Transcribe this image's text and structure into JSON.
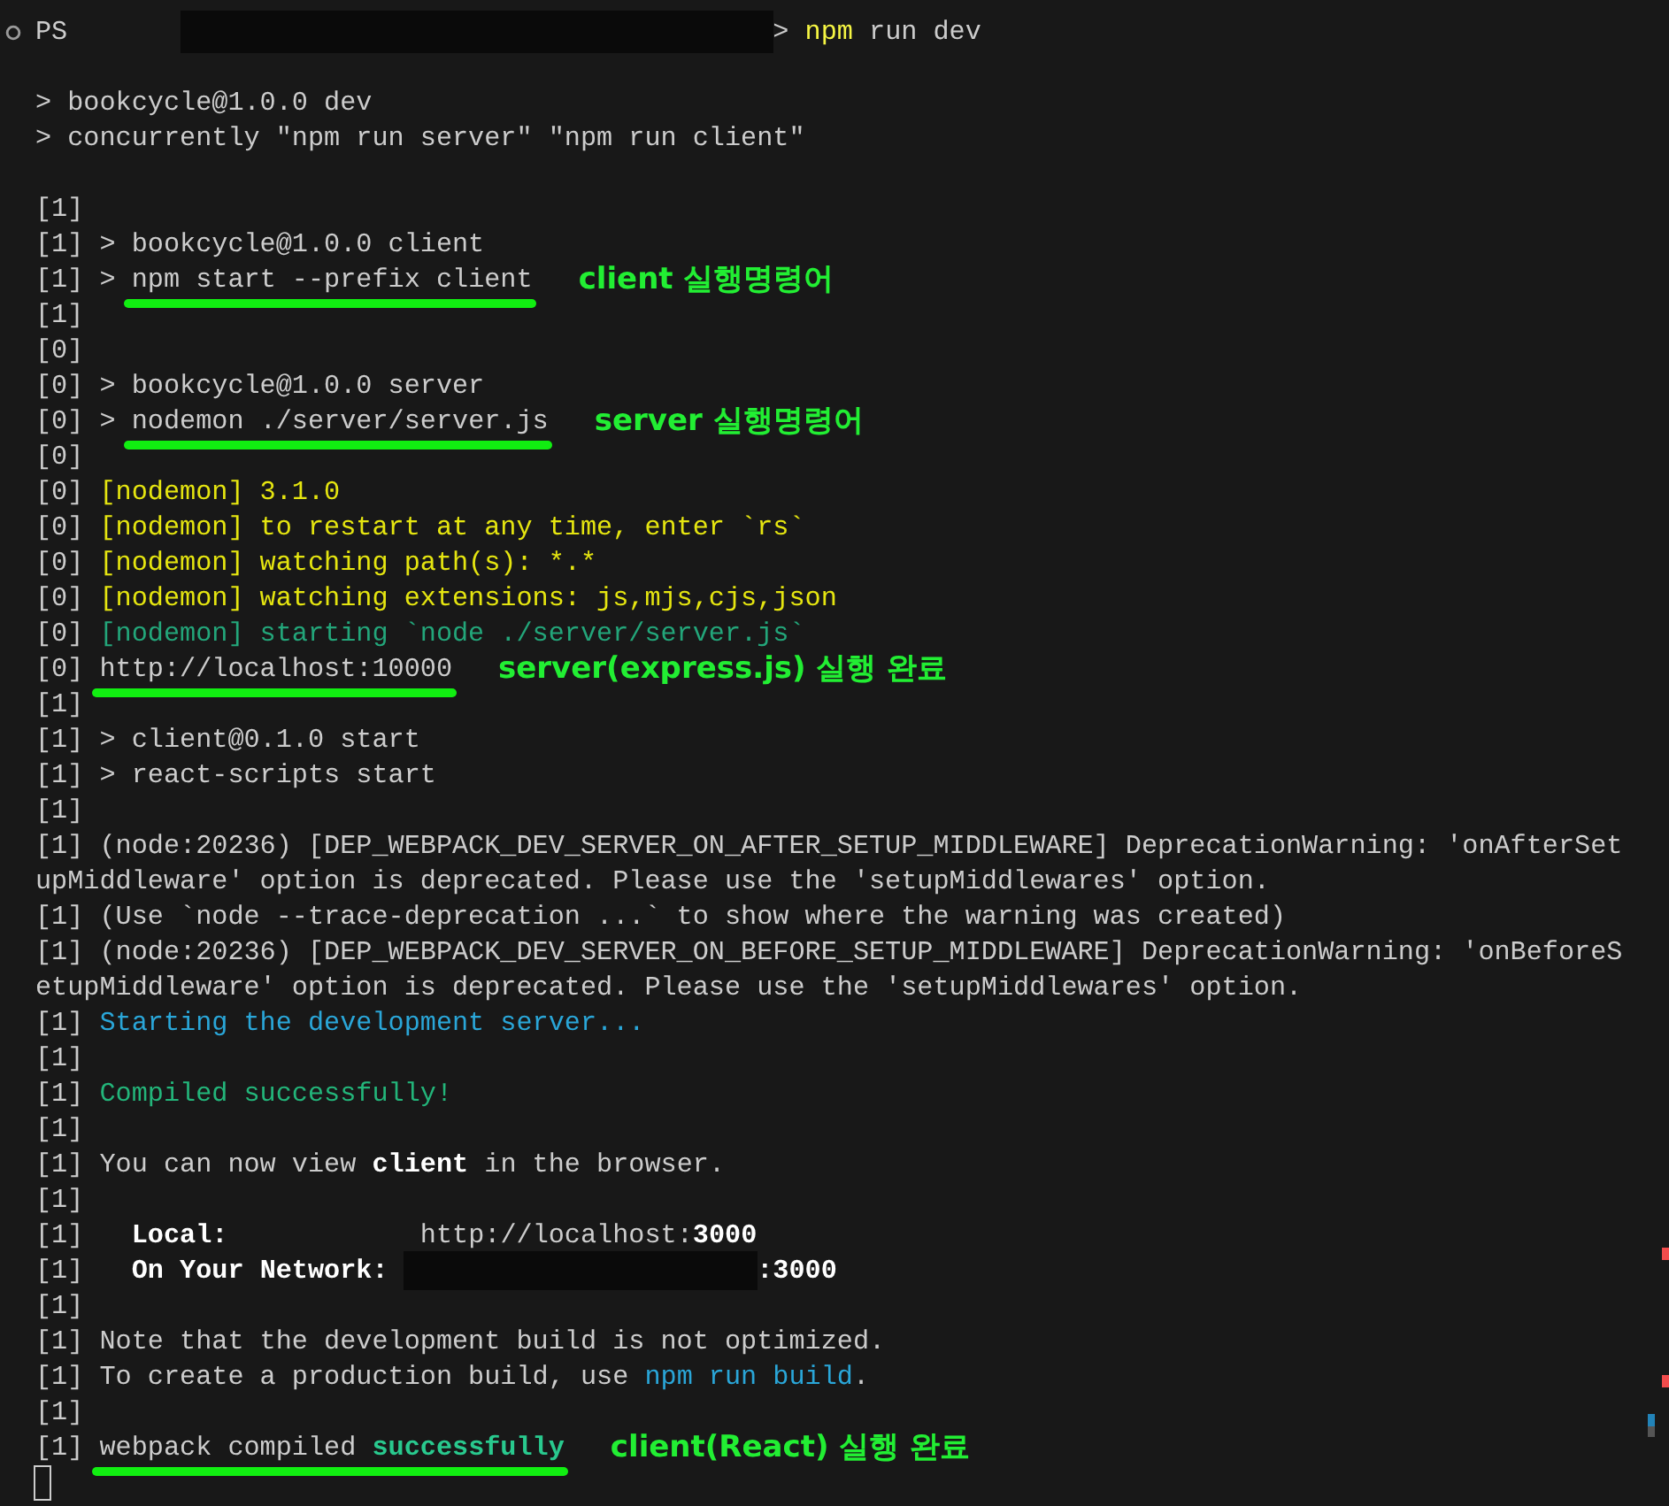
{
  "terminal": {
    "lines": [
      {
        "segments": [
          {
            "kind": "prompt_icon"
          },
          {
            "kind": "plain",
            "text": "PS"
          },
          {
            "kind": "redacted_path"
          },
          {
            "kind": "plain",
            "text": "> "
          },
          {
            "kind": "command",
            "text": "npm"
          },
          {
            "kind": "plain",
            "text": " run dev"
          }
        ],
        "blank_line_after": true
      },
      {
        "segments": [
          {
            "kind": "plain",
            "text": "> bookcycle@1.0.0 dev"
          }
        ]
      },
      {
        "segments": [
          {
            "kind": "plain",
            "text": "> concurrently \"npm run server\" \"npm run client\""
          }
        ],
        "blank_line_after": true
      },
      {
        "segments": [
          {
            "kind": "plain",
            "text": "[1]"
          }
        ]
      },
      {
        "segments": [
          {
            "kind": "plain",
            "text": "[1] > bookcycle@1.0.0 client"
          }
        ]
      },
      {
        "segments": [
          {
            "kind": "plain",
            "text": "[1] > "
          },
          {
            "kind": "underlined",
            "parts": [
              {
                "kind": "plain",
                "text": "npm start --prefix client"
              }
            ]
          }
        ],
        "note": "client 실행명령어"
      },
      {
        "segments": [
          {
            "kind": "plain",
            "text": "[1]"
          }
        ]
      },
      {
        "segments": [
          {
            "kind": "plain",
            "text": "[0]"
          }
        ]
      },
      {
        "segments": [
          {
            "kind": "plain",
            "text": "[0] > bookcycle@1.0.0 server"
          }
        ]
      },
      {
        "segments": [
          {
            "kind": "plain",
            "text": "[0] > "
          },
          {
            "kind": "underlined",
            "parts": [
              {
                "kind": "plain",
                "text": "nodemon ./server/server.js"
              }
            ]
          }
        ],
        "note": "server 실행명령어"
      },
      {
        "segments": [
          {
            "kind": "plain",
            "text": "[0]"
          }
        ]
      },
      {
        "segments": [
          {
            "kind": "plain",
            "text": "[0] "
          },
          {
            "kind": "yellow",
            "text": "[nodemon] 3.1.0"
          }
        ]
      },
      {
        "segments": [
          {
            "kind": "plain",
            "text": "[0] "
          },
          {
            "kind": "yellow",
            "text": "[nodemon] to restart at any time, enter `rs`"
          }
        ]
      },
      {
        "segments": [
          {
            "kind": "plain",
            "text": "[0] "
          },
          {
            "kind": "yellow",
            "text": "[nodemon] watching path(s): *.*"
          }
        ]
      },
      {
        "segments": [
          {
            "kind": "plain",
            "text": "[0] "
          },
          {
            "kind": "yellow",
            "text": "[nodemon] watching extensions: js,mjs,cjs,json"
          }
        ]
      },
      {
        "segments": [
          {
            "kind": "plain",
            "text": "[0] "
          },
          {
            "kind": "teal",
            "text": "[nodemon] starting `node ./server/server.js`"
          }
        ]
      },
      {
        "segments": [
          {
            "kind": "plain",
            "text": "[0] "
          },
          {
            "kind": "underlined",
            "parts": [
              {
                "kind": "plain",
                "text": "http://localhost:10000"
              }
            ]
          }
        ],
        "note": "server(express.js) 실행 완료"
      },
      {
        "segments": [
          {
            "kind": "plain",
            "text": "[1]"
          }
        ]
      },
      {
        "segments": [
          {
            "kind": "plain",
            "text": "[1] > client@0.1.0 start"
          }
        ]
      },
      {
        "segments": [
          {
            "kind": "plain",
            "text": "[1] > react-scripts start"
          }
        ]
      },
      {
        "segments": [
          {
            "kind": "plain",
            "text": "[1]"
          }
        ]
      },
      {
        "segments": [
          {
            "kind": "plain",
            "text": "[1] (node:20236) [DEP_WEBPACK_DEV_SERVER_ON_AFTER_SETUP_MIDDLEWARE] DeprecationWarning: 'onAfterSet"
          }
        ]
      },
      {
        "segments": [
          {
            "kind": "plain",
            "text": "upMiddleware' option is deprecated. Please use the 'setupMiddlewares' option."
          }
        ]
      },
      {
        "segments": [
          {
            "kind": "plain",
            "text": "[1] (Use `node --trace-deprecation ...` to show where the warning was created)"
          }
        ]
      },
      {
        "segments": [
          {
            "kind": "plain",
            "text": "[1] (node:20236) [DEP_WEBPACK_DEV_SERVER_ON_BEFORE_SETUP_MIDDLEWARE] DeprecationWarning: 'onBeforeS"
          }
        ]
      },
      {
        "segments": [
          {
            "kind": "plain",
            "text": "etupMiddleware' option is deprecated. Please use the 'setupMiddlewares' option."
          }
        ]
      },
      {
        "segments": [
          {
            "kind": "plain",
            "text": "[1] "
          },
          {
            "kind": "blue",
            "text": "Starting the development server..."
          }
        ]
      },
      {
        "segments": [
          {
            "kind": "plain",
            "text": "[1]"
          }
        ]
      },
      {
        "segments": [
          {
            "kind": "plain",
            "text": "[1] "
          },
          {
            "kind": "green",
            "text": "Compiled successfully!"
          }
        ]
      },
      {
        "segments": [
          {
            "kind": "plain",
            "text": "[1]"
          }
        ]
      },
      {
        "segments": [
          {
            "kind": "plain",
            "text": "[1] You can now view "
          },
          {
            "kind": "bold",
            "text": "client"
          },
          {
            "kind": "plain",
            "text": " in the browser."
          }
        ]
      },
      {
        "segments": [
          {
            "kind": "plain",
            "text": "[1]"
          }
        ]
      },
      {
        "segments": [
          {
            "kind": "plain",
            "text": "[1]   "
          },
          {
            "kind": "bold",
            "text": "Local:"
          },
          {
            "kind": "plain",
            "text": "            http://localhost:"
          },
          {
            "kind": "bold",
            "text": "3000"
          }
        ]
      },
      {
        "segments": [
          {
            "kind": "plain",
            "text": "[1]   "
          },
          {
            "kind": "bold",
            "text": "On Your Network:"
          },
          {
            "kind": "redacted_address"
          },
          {
            "kind": "bold",
            "text": ":3000"
          }
        ]
      },
      {
        "segments": [
          {
            "kind": "plain",
            "text": "[1]"
          }
        ]
      },
      {
        "segments": [
          {
            "kind": "plain",
            "text": "[1] Note that the development build is not optimized."
          }
        ]
      },
      {
        "segments": [
          {
            "kind": "plain",
            "text": "[1] To create a production build, use "
          },
          {
            "kind": "blue",
            "text": "npm run build"
          },
          {
            "kind": "plain",
            "text": "."
          }
        ]
      },
      {
        "segments": [
          {
            "kind": "plain",
            "text": "[1]"
          }
        ]
      },
      {
        "segments": [
          {
            "kind": "plain",
            "text": "[1] "
          },
          {
            "kind": "underlined",
            "parts": [
              {
                "kind": "plain",
                "text": "webpack compiled "
              },
              {
                "kind": "success",
                "text": "successfully"
              }
            ]
          }
        ],
        "note": "client(React) 실행 완료"
      },
      {
        "segments": [
          {
            "kind": "cursor"
          }
        ]
      }
    ]
  }
}
